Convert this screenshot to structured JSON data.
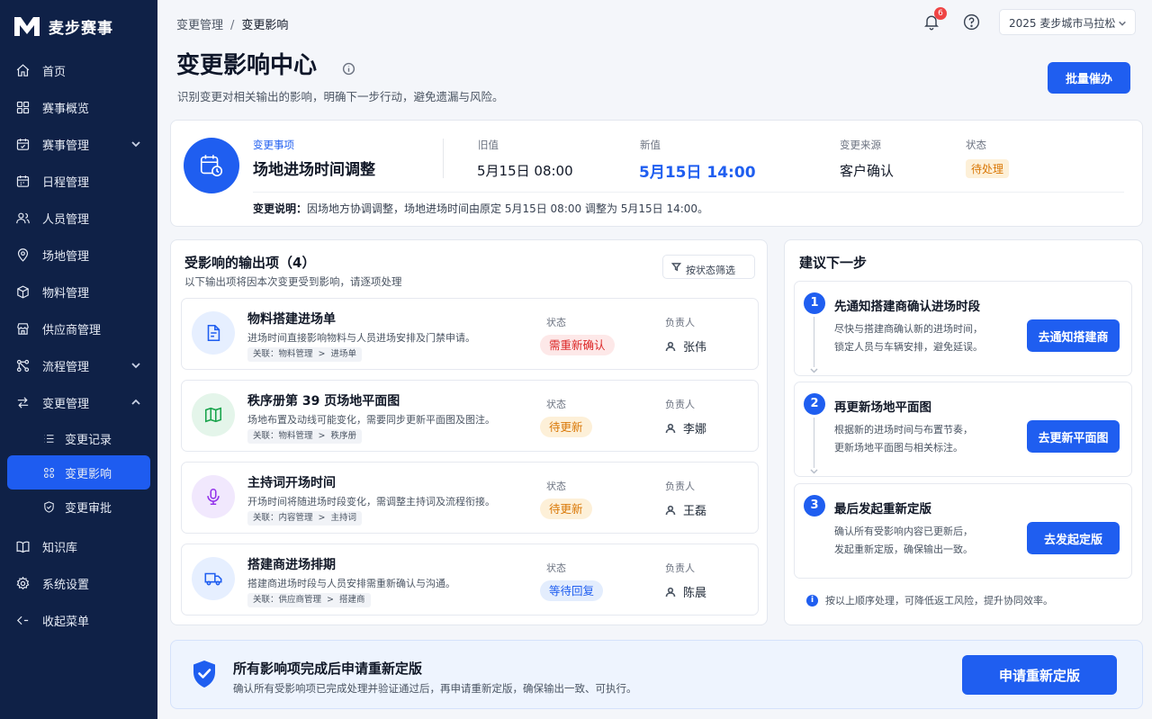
{
  "brand": {
    "name": "麦步赛事"
  },
  "sidebar": {
    "items": [
      {
        "label": "首页",
        "icon": "home-icon"
      },
      {
        "label": "赛事概览",
        "icon": "grid-icon"
      },
      {
        "label": "赛事管理",
        "icon": "calendar-check-icon"
      },
      {
        "label": "日程管理",
        "icon": "calendar-icon"
      },
      {
        "label": "人员管理",
        "icon": "users-icon"
      },
      {
        "label": "场地管理",
        "icon": "map-pin-icon"
      },
      {
        "label": "物料管理",
        "icon": "box-icon"
      },
      {
        "label": "供应商管理",
        "icon": "store-icon"
      },
      {
        "label": "流程管理",
        "icon": "workflow-icon"
      },
      {
        "label": "变更管理",
        "icon": "swap-icon"
      },
      {
        "label": "知识库",
        "icon": "book-icon"
      },
      {
        "label": "系统设置",
        "icon": "gear-icon"
      },
      {
        "label": "收起菜单",
        "icon": "collapse-icon"
      }
    ],
    "sub_items": [
      {
        "label": "变更记录",
        "icon": "list-icon"
      },
      {
        "label": "变更影响",
        "icon": "impact-icon"
      },
      {
        "label": "变更审批",
        "icon": "shield-check-icon"
      }
    ]
  },
  "header": {
    "breadcrumb": [
      "变更管理",
      "变更影响"
    ],
    "breadcrumb_sep": "/",
    "notification_count": "6",
    "event_selector": "2025 麦步城市马拉松"
  },
  "page": {
    "title": "变更影响中心",
    "subtitle": "识别变更对相关输出的影响，明确下一步行动，避免遗漏与风险。",
    "batch_button": "批量催办"
  },
  "change": {
    "item_label": "变更事项",
    "item_title": "场地进场时间调整",
    "old_label": "旧值",
    "old_value": "5月15日 08:00",
    "new_label": "新值",
    "new_value": "5月15日 14:00",
    "source_label": "变更来源",
    "source_value": "客户确认",
    "status_label": "状态",
    "status_value": "待处理",
    "desc_label": "变更说明：",
    "desc_text": "因场地方协调调整，场地进场时间由原定 5月15日 08:00 调整为 5月15日 14:00。"
  },
  "affected": {
    "title": "受影响的输出项（4）",
    "subtitle": "以下输出项将因本次变更受到影响，请逐项处理",
    "filter_label": "按状态筛选",
    "status_label": "状态",
    "owner_label": "负责人",
    "relation_prefix": "关联：",
    "relation_sep": ">",
    "items": [
      {
        "name": "物料搭建进场单",
        "desc": "进场时间直接影响物料与人员进场安排及门禁申请。",
        "rel_a": "物料管理",
        "rel_b": "进场单",
        "status": "需重新确认",
        "owner": "张伟",
        "icon": "document-icon"
      },
      {
        "name": "秩序册第 39 页场地平面图",
        "desc": "场地布置及动线可能变化，需要同步更新平面图及图注。",
        "rel_a": "物料管理",
        "rel_b": "秩序册",
        "status": "待更新",
        "owner": "李娜",
        "icon": "map-icon"
      },
      {
        "name": "主持词开场时间",
        "desc": "开场时间将随进场时段变化，需调整主持词及流程衔接。",
        "rel_a": "内容管理",
        "rel_b": "主持词",
        "status": "待更新",
        "owner": "王磊",
        "icon": "microphone-icon"
      },
      {
        "name": "搭建商进场排期",
        "desc": "搭建商进场时段与人员安排需重新确认与沟通。",
        "rel_a": "供应商管理",
        "rel_b": "搭建商",
        "status": "等待回复",
        "owner": "陈晨",
        "icon": "truck-icon"
      }
    ]
  },
  "suggest": {
    "title": "建议下一步",
    "steps": [
      {
        "num": "1",
        "title": "先通知搭建商确认进场时段",
        "desc1": "尽快与搭建商确认新的进场时间，",
        "desc2": "锁定人员与车辆安排，避免延误。",
        "button": "去通知搭建商"
      },
      {
        "num": "2",
        "title": "再更新场地平面图",
        "desc1": "根据新的进场时间与布置节奏，",
        "desc2": "更新场地平面图与相关标注。",
        "button": "去更新平面图"
      },
      {
        "num": "3",
        "title": "最后发起重新定版",
        "desc1": "确认所有受影响内容已更新后，",
        "desc2": "发起重新定版，确保输出一致。",
        "button": "去发起定版"
      }
    ],
    "note_icon": "i",
    "note": "按以上顺序处理，可降低返工风险，提升协同效率。"
  },
  "banner": {
    "title": "所有影响项完成后申请重新定版",
    "desc": "确认所有受影响项已完成处理并验证通过后，再申请重新定版，确保输出一致、可执行。",
    "button": "申请重新定版"
  },
  "colors": {
    "sidebar_bg": "#0f2147",
    "accent": "#1f5ef0",
    "status_red_bg": "#fde8e8",
    "status_red_fg": "#dc2626",
    "status_orange_bg": "#fdf0d8",
    "status_orange_fg": "#d97706",
    "status_blue_bg": "#e3edfd",
    "status_blue_fg": "#1f5ef0"
  }
}
